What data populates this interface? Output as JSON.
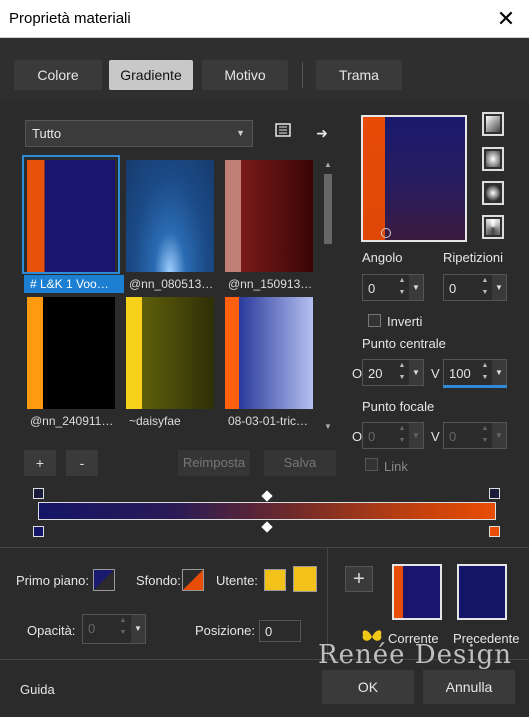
{
  "window": {
    "title": "Proprietà materiali"
  },
  "tabs": [
    {
      "label": "Colore",
      "active": false
    },
    {
      "label": "Gradiente",
      "active": true
    },
    {
      "label": "Motivo",
      "active": false
    },
    {
      "label": "Trama",
      "active": false
    }
  ],
  "library": {
    "category": "Tutto",
    "swatches": [
      {
        "caption": "# L&K 1 Voo…",
        "selected": true
      },
      {
        "caption": "@nn_080513…",
        "selected": false
      },
      {
        "caption": "@nn_150913…",
        "selected": false
      },
      {
        "caption": "@nn_240911…",
        "selected": false
      },
      {
        "caption": "~daisyfae",
        "selected": false
      },
      {
        "caption": "08-03-01-tric…",
        "selected": false
      }
    ],
    "add_label": "+",
    "remove_label": "-",
    "reset_label": "Reimposta",
    "save_label": "Salva"
  },
  "settings": {
    "angle_label": "Angolo",
    "angle_value": "0",
    "repeats_label": "Ripetizioni",
    "repeats_value": "0",
    "invert_label": "Inverti",
    "center_label": "Punto centrale",
    "center_o_label": "O",
    "center_o_value": "20",
    "center_v_label": "V",
    "center_v_value": "100",
    "focal_label": "Punto focale",
    "focal_o_label": "O",
    "focal_o_value": "0",
    "focal_v_label": "V",
    "focal_v_value": "0",
    "link_label": "Link"
  },
  "bottom": {
    "foreground_label": "Primo piano:",
    "background_label": "Sfondo:",
    "user_label": "Utente:",
    "opacity_label": "Opacità:",
    "opacity_value": "0",
    "position_label": "Posizione:",
    "position_value": "0",
    "current_label": "Corrente",
    "previous_label": "Precedente",
    "add_label": "+"
  },
  "footer": {
    "help_label": "Guida",
    "ok_label": "OK",
    "cancel_label": "Annulla",
    "watermark": "Renée Design"
  },
  "colors": {
    "navy": "#141566",
    "orange": "#e84d06",
    "user_yellow": "#f2c21b",
    "accent_blue": "#1d7fd1"
  }
}
